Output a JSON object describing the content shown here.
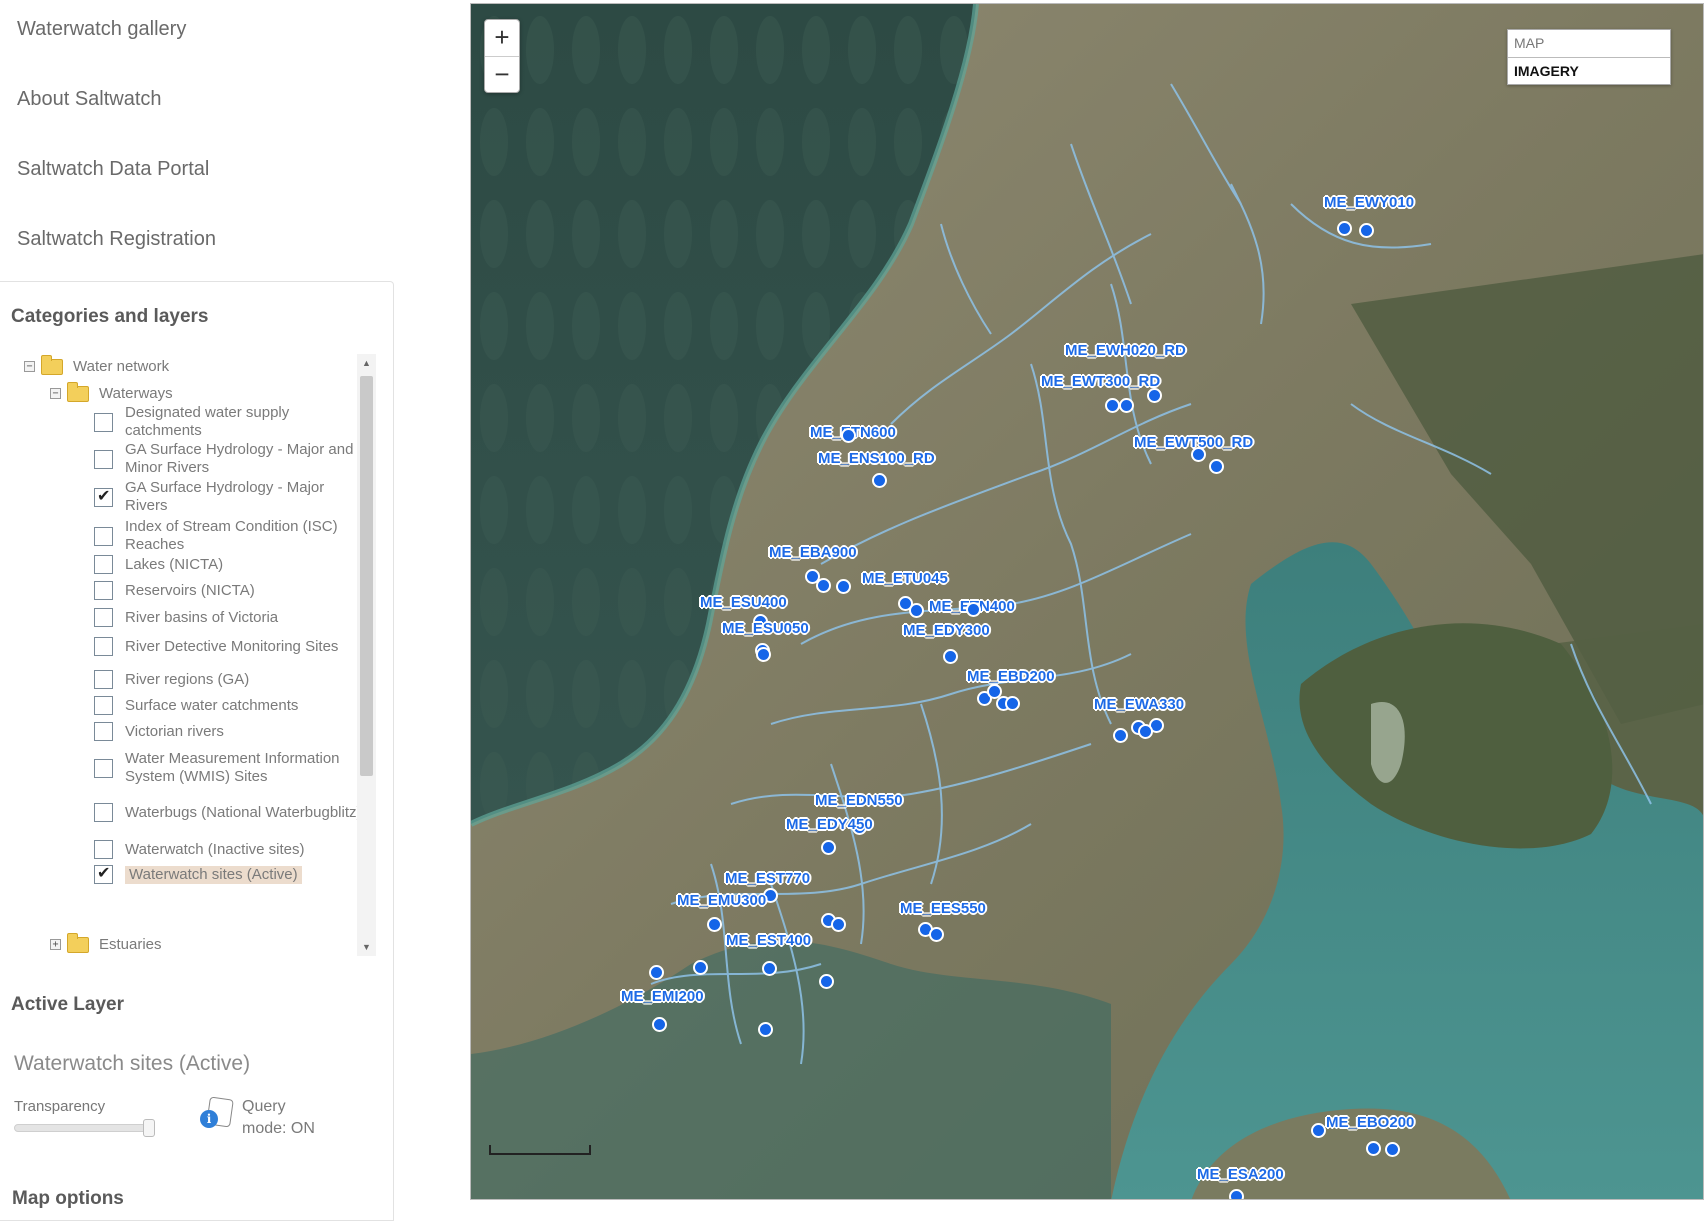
{
  "nav": {
    "links": [
      "Waterwatch gallery",
      "About Saltwatch",
      "Saltwatch Data Portal",
      "Saltwatch Registration"
    ]
  },
  "categories": {
    "title": "Categories and layers",
    "groups": {
      "water_network": "Water network",
      "waterways": "Waterways",
      "estuaries": "Estuaries"
    },
    "layers": [
      {
        "label": "Designated water supply catchments",
        "checked": false
      },
      {
        "label": "GA Surface Hydrology - Major and Minor Rivers",
        "checked": false
      },
      {
        "label": "GA Surface Hydrology - Major Rivers",
        "checked": true
      },
      {
        "label": "Index of Stream Condition (ISC) Reaches",
        "checked": false
      },
      {
        "label": "Lakes (NICTA)",
        "checked": false
      },
      {
        "label": "Reservoirs (NICTA)",
        "checked": false
      },
      {
        "label": "River basins of Victoria",
        "checked": false
      },
      {
        "label": "River Detective Monitoring Sites",
        "checked": false
      },
      {
        "label": "River regions (GA)",
        "checked": false
      },
      {
        "label": "Surface water catchments",
        "checked": false
      },
      {
        "label": "Victorian rivers",
        "checked": false
      },
      {
        "label": "Water Measurement Information System (WMIS) Sites",
        "checked": false
      },
      {
        "label": "Waterbugs (National Waterbugblitz)",
        "checked": false
      },
      {
        "label": "Waterwatch (Inactive sites)",
        "checked": false
      },
      {
        "label": "Waterwatch sites (Active)",
        "checked": true,
        "highlighted": true
      }
    ]
  },
  "active_layer": {
    "title": "Active Layer",
    "name": "Waterwatch sites (Active)",
    "transparency_label": "Transparency",
    "transparency": 1.0,
    "query_mode": "Query mode: ON"
  },
  "map_options_title": "Map options",
  "map": {
    "zoom_in": "+",
    "zoom_out": "−",
    "basemap_options": [
      "MAP",
      "IMAGERY"
    ],
    "basemap_selected": "IMAGERY",
    "site_color": "#1565e8",
    "sites": [
      "ME_EWY010",
      "ME_EWH020_RD",
      "ME_EWT300_RD",
      "ME_EWT500_RD",
      "ME_ETN600",
      "ME_ENS100_RD",
      "ME_EBA900",
      "ME_ETU045",
      "ME_ESU400",
      "ME_ETN400",
      "ME_ESU050",
      "ME_EDY300",
      "ME_EBD200",
      "ME_EWA330",
      "ME_EDN550",
      "ME_EDY450",
      "ME_EST770",
      "ME_EMU300",
      "ME_EES550",
      "ME_EST400",
      "ME_EMI200",
      "ME_EBO200",
      "ME_ESA200"
    ]
  }
}
